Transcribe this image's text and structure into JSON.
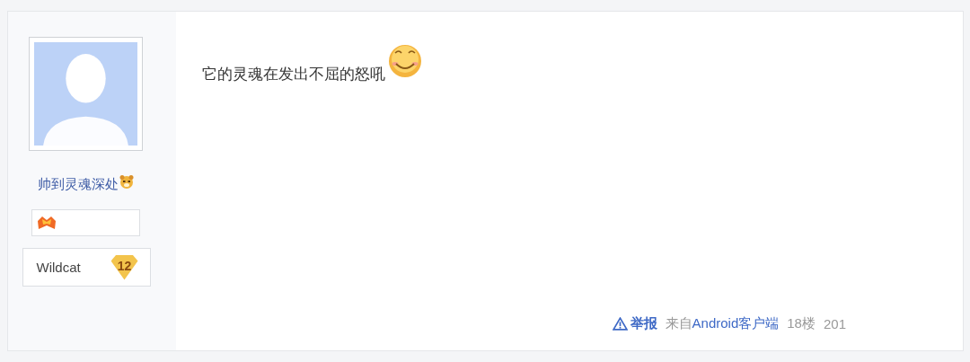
{
  "author": {
    "name": "帅到灵魂深处",
    "level_title": "Wildcat",
    "level_number": "12"
  },
  "post": {
    "text": "它的灵魂在发出不屈的怒吼"
  },
  "footer": {
    "report": "举报",
    "source_prefix": "来自",
    "source": "Android客户端",
    "floor": "18楼",
    "time": "201"
  }
}
